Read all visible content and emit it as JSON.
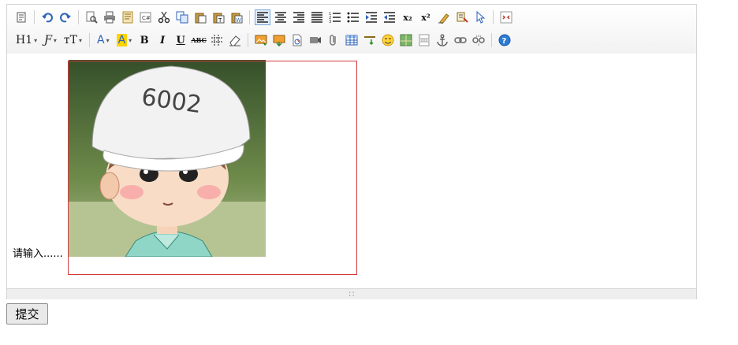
{
  "toolbar": {
    "heading_label": "H1",
    "font_family_label": "Ƒ",
    "font_size_label": "ᴛT",
    "font_color_label": "A",
    "back_color_label": "A",
    "bold_label": "B",
    "italic_label": "I",
    "underline_label": "U",
    "strike_label": "ABC",
    "dropdown_arrow": "▾",
    "subscript_label": "x₂",
    "superscript_label": "x²"
  },
  "editor": {
    "placeholder": "请输入......",
    "resize_grip": "∷"
  },
  "form": {
    "submit_label": "提交"
  },
  "colors": {
    "image_border": "#d23b3b",
    "highlight_yellow": "#ffd400",
    "help_blue": "#2b7bd4"
  }
}
